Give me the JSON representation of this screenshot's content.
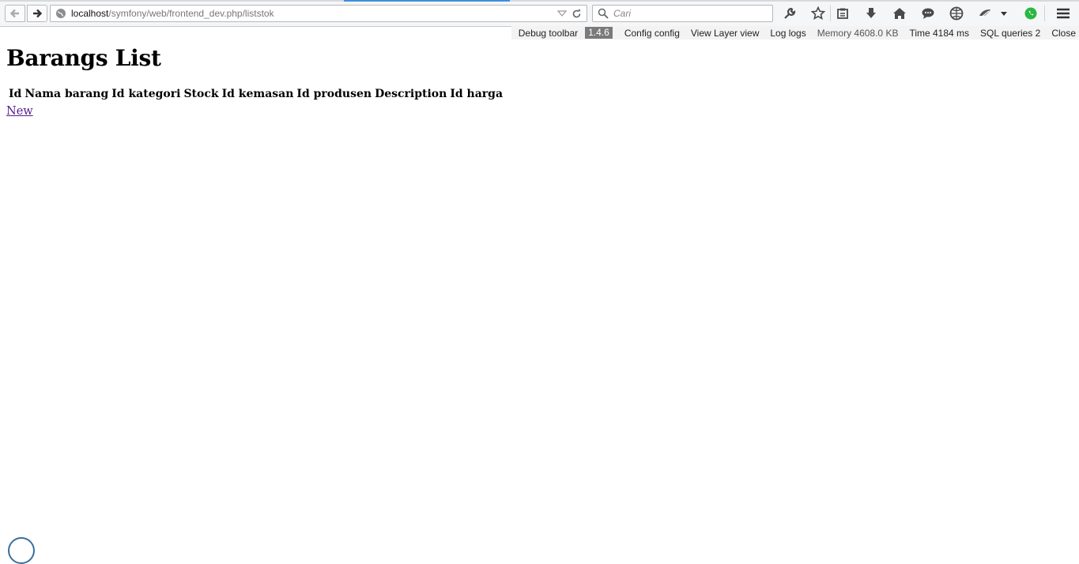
{
  "browser": {
    "url_host": "localhost",
    "url_path": "/symfony/web/frontend_dev.php/liststok",
    "search_placeholder": "Cari"
  },
  "debug_toolbar": {
    "label": "Debug toolbar",
    "version": "1.4.6",
    "config": "Config config",
    "view": "View Layer view",
    "logs": "Log logs",
    "memory": "Memory 4608.0 KB",
    "time": "Time 4184 ms",
    "sql": "SQL queries 2",
    "close": "Close"
  },
  "page": {
    "title": "Barangs List",
    "columns": [
      "Id",
      "Nama barang",
      "Id kategori",
      "Stock",
      "Id kemasan",
      "Id produsen",
      "Description",
      "Id harga"
    ],
    "new_link": "New"
  }
}
